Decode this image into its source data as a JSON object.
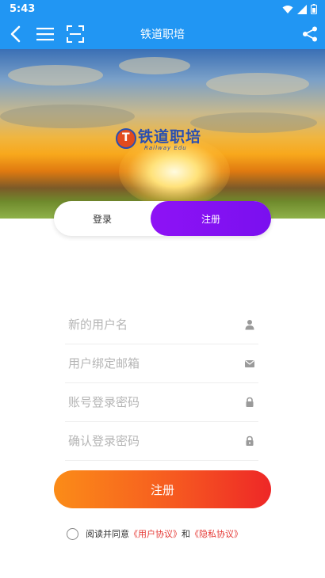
{
  "status_bar": {
    "time": "5:43"
  },
  "app_bar": {
    "title": "铁道职培"
  },
  "icons": {
    "back": "back-arrow-icon",
    "menu": "menu-icon",
    "scan": "scan-icon",
    "share": "share-icon",
    "user": "user-icon",
    "email": "email-icon",
    "lock": "lock-icon"
  },
  "banner": {
    "logo_text": "铁道职培",
    "logo_mark": "T",
    "logo_sub": "Railway Edu"
  },
  "tabs": [
    {
      "label": "登录"
    },
    {
      "label": "注册"
    }
  ],
  "form": {
    "username_placeholder": "新的用户名",
    "email_placeholder": "用户绑定邮箱",
    "password_placeholder": "账号登录密码",
    "confirm_placeholder": "确认登录密码"
  },
  "submit_label": "注册",
  "agreement": {
    "prefix": "阅读并同意",
    "user_agreement": "《用户协议》",
    "and": "和",
    "privacy_agreement": "《隐私协议》"
  },
  "colors": {
    "primary": "#2196F3",
    "tab_active": "#8e12f5",
    "button_start": "#fb8c18",
    "button_end": "#ee2727",
    "link": "#e53935"
  }
}
